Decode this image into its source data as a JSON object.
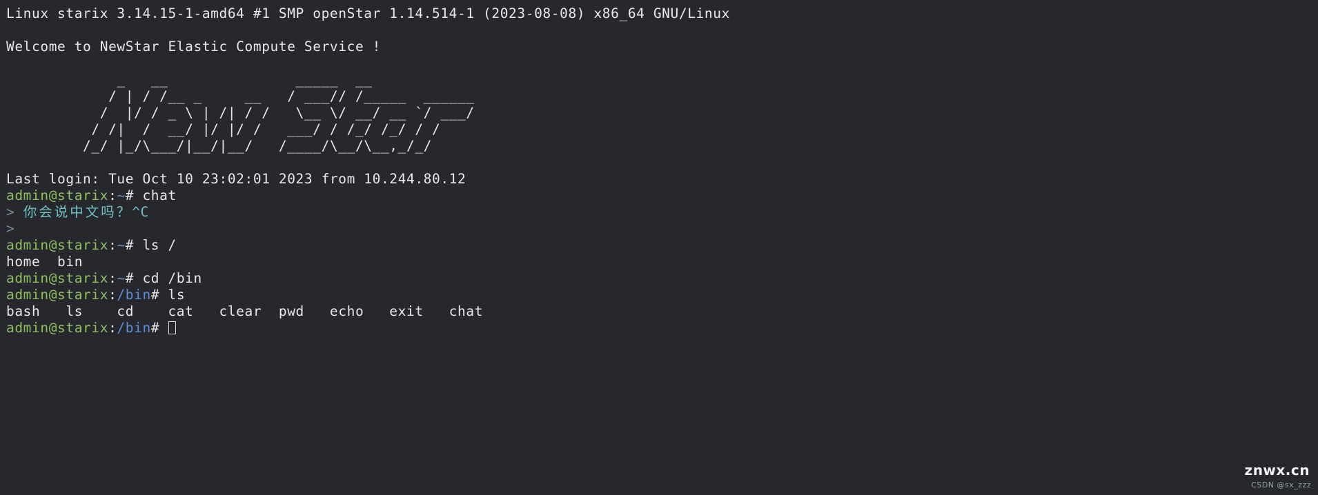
{
  "terminal": {
    "colors": {
      "background": "#26282e",
      "foreground": "#e6e8ea",
      "user_green": "#8fbf5f",
      "path_blue": "#5b8fd6",
      "chat_teal": "#6fc2c2",
      "chat_prompt_gray": "#7b8a93"
    },
    "kernel_line": "Linux starix 3.14.15-1-amd64 #1 SMP openStar 1.14.514-1 (2023-08-08) x86_64 GNU/Linux",
    "welcome_line": "Welcome to NewStar Elastic Compute Service !",
    "banner": [
      "             _   __               _____  __",
      "            / | / /__ _     __   / ___// /_____  ______",
      "           /  |/ / _ \\ | /| / /   \\__ \\/ __/ __ `/ ___/",
      "          / /|  /  __/ |/ |/ /   ___/ / /_/ /_/ / /",
      "         /_/ |_/\\___/|__/|__/   /____/\\__/\\__,_/_/"
    ],
    "last_login": "Last login: Tue Oct 10 23:02:01 2023 from 10.244.80.12",
    "lines": [
      {
        "type": "prompt",
        "user": "admin@starix",
        "colon": ":",
        "path": "~",
        "hash": "# ",
        "command": "chat"
      },
      {
        "type": "chat",
        "prompt": "> ",
        "text": "你会说中文吗？",
        "ctrlc": "^C"
      },
      {
        "type": "chat",
        "prompt": ">",
        "text": "",
        "ctrlc": ""
      },
      {
        "type": "prompt",
        "user": "admin@starix",
        "colon": ":",
        "path": "~",
        "hash": "# ",
        "command": "ls /"
      },
      {
        "type": "output",
        "text": "home  bin"
      },
      {
        "type": "prompt",
        "user": "admin@starix",
        "colon": ":",
        "path": "~",
        "hash": "# ",
        "command": "cd /bin"
      },
      {
        "type": "prompt",
        "user": "admin@starix",
        "colon": ":",
        "path": "/bin",
        "hash": "# ",
        "command": "ls"
      },
      {
        "type": "output",
        "text": "bash   ls    cd    cat   clear  pwd   echo   exit   chat"
      },
      {
        "type": "prompt-cursor",
        "user": "admin@starix",
        "colon": ":",
        "path": "/bin",
        "hash": "# ",
        "command": ""
      }
    ],
    "bin_commands": [
      "bash",
      "ls",
      "cd",
      "cat",
      "clear",
      "pwd",
      "echo",
      "exit",
      "chat"
    ],
    "root_entries": [
      "home",
      "bin"
    ]
  },
  "watermark": {
    "text": "znwx.cn",
    "sub": "CSDN @sx_zzz"
  }
}
